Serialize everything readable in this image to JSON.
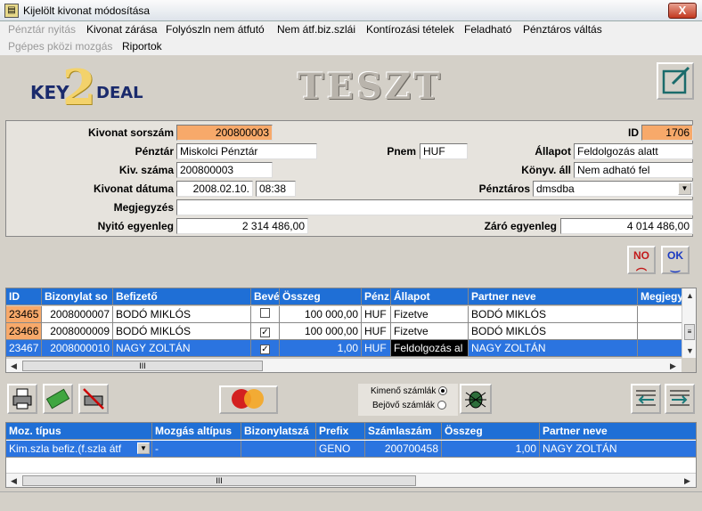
{
  "window": {
    "title": "Kijelölt kivonat módosítása",
    "close": "X"
  },
  "menu": {
    "row1": [
      {
        "label": "Pénztár nyitás",
        "disabled": true
      },
      {
        "label": "Kivonat zárása",
        "disabled": false
      },
      {
        "label": "Folyószln nem átfutó",
        "disabled": false
      },
      {
        "label": "Nem átf.biz.szlái",
        "disabled": false
      },
      {
        "label": "Kontírozási tételek",
        "disabled": false
      },
      {
        "label": "Feladható",
        "disabled": false
      },
      {
        "label": "Pénztáros váltás",
        "disabled": false
      }
    ],
    "row2": [
      {
        "label": "Pgépes pközi mozgás",
        "disabled": true
      },
      {
        "label": "Riportok",
        "disabled": false
      }
    ]
  },
  "banner": {
    "logo_left": "KEY",
    "logo_mid": "2",
    "logo_right": "DEAL",
    "env": "TESZT"
  },
  "form": {
    "kivonat_sorszam_label": "Kivonat sorszám",
    "kivonat_sorszam": "200800003",
    "id_label": "ID",
    "id": "1706",
    "penztar_label": "Pénztár",
    "penztar": "Miskolci Pénztár",
    "pnem_label": "Pnem",
    "pnem": "HUF",
    "allapot_label": "Állapot",
    "allapot": "Feldolgozás alatt",
    "kiv_szama_label": "Kiv. száma",
    "kiv_szama": "200800003",
    "konyv_all_label": "Könyv. áll",
    "konyv_all": "Nem adható fel",
    "kivonat_datuma_label": "Kivonat dátuma",
    "datum": "2008.02.10.",
    "ido": "08:38",
    "penztaros_label": "Pénztáros",
    "penztaros": "dmsdba",
    "megjegyzes_label": "Megjegyzés",
    "megjegyzes": "",
    "nyito_label": "Nyitó egyenleg",
    "nyito": "2 314 486,00",
    "zaro_label": "Záró egyenleg",
    "zaro": "4 014 486,00"
  },
  "buttons": {
    "no": "NO",
    "ok": "OK"
  },
  "grid1": {
    "headers": [
      "ID",
      "Bizonylat so",
      "Befizető",
      "Bevé",
      "Összeg",
      "Pénz",
      "Állapot",
      "Partner neve",
      "Megjegy"
    ],
    "rows": [
      {
        "id": "23465",
        "biz": "2008000007",
        "befizeto": "BODÓ MIKLÓS",
        "beve": false,
        "osszeg": "100 000,00",
        "penz": "HUF",
        "allapot": "Fizetve",
        "partner": "BODÓ MIKLÓS",
        "megj": ""
      },
      {
        "id": "23466",
        "biz": "2008000009",
        "befizeto": "BODÓ MIKLÓS",
        "beve": true,
        "osszeg": "100 000,00",
        "penz": "HUF",
        "allapot": "Fizetve",
        "partner": "BODÓ MIKLÓS",
        "megj": ""
      },
      {
        "id": "23467",
        "biz": "2008000010",
        "befizeto": "NAGY   ZOLTÁN",
        "beve": true,
        "osszeg": "1,00",
        "penz": "HUF",
        "allapot": "Feldolgozás al",
        "partner": "NAGY   ZOLTÁN",
        "megj": ""
      }
    ],
    "scroll_thumb": "III"
  },
  "tool2": {
    "kimeno": "Kimenő számlák",
    "bejovo": "Bejövő számlák"
  },
  "grid2": {
    "headers": [
      "Moz. típus",
      "Mozgás altípus",
      "Bizonylatszá",
      "Prefix",
      "Számlaszám",
      "Összeg",
      "Partner neve"
    ],
    "rows": [
      {
        "tipus": "Kim.szla befiz.(f.szla átf",
        "altipus": "-",
        "biz": "",
        "prefix": "GENO",
        "szamla": "200700458",
        "osszeg": "1,00",
        "partner": "NAGY   ZOLTÁN"
      }
    ],
    "scroll_thumb": "III"
  },
  "colors": {
    "accent": "#1f6fd6",
    "orange": "#f7a96a",
    "selection": "#2b74e0"
  }
}
